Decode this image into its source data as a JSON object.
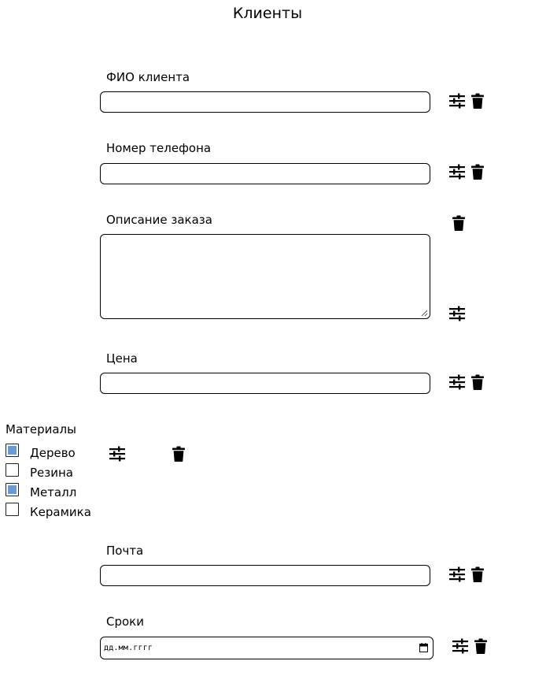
{
  "page": {
    "title": "Клиенты"
  },
  "fields": {
    "fio": {
      "label": "ФИО клиента",
      "value": ""
    },
    "phone": {
      "label": "Номер телефона",
      "value": ""
    },
    "description": {
      "label": "Описание заказа",
      "value": ""
    },
    "price": {
      "label": "Цена",
      "value": ""
    },
    "email": {
      "label": "Почта",
      "value": ""
    },
    "deadline": {
      "label": "Сроки",
      "placeholder": "дд.мм.гггг"
    }
  },
  "materials": {
    "label": "Материалы",
    "options": [
      {
        "label": "Дерево",
        "checked": true
      },
      {
        "label": "Резина",
        "checked": false
      },
      {
        "label": "Металл",
        "checked": true
      },
      {
        "label": "Керамика",
        "checked": false
      }
    ]
  },
  "icons": {
    "settings": "sliders-icon",
    "delete": "trash-icon"
  },
  "colors": {
    "checkbox_fill": "#6a9bd0",
    "border": "#000000",
    "background": "#ffffff"
  }
}
